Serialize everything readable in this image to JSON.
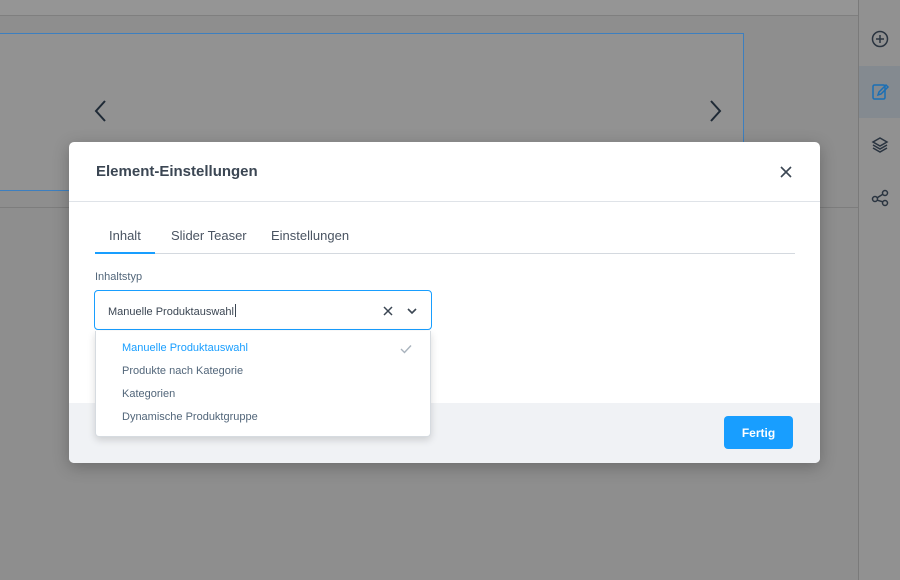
{
  "modal": {
    "title": "Element-Einstellungen",
    "tabs": [
      {
        "label": "Inhalt",
        "active": true
      },
      {
        "label": "Slider Teaser",
        "active": false
      },
      {
        "label": "Einstellungen",
        "active": false
      }
    ],
    "field_label": "Inhaltstyp",
    "select": {
      "value": "Manuelle Produktauswahl",
      "options": [
        {
          "label": "Manuelle Produktauswahl",
          "selected": true
        },
        {
          "label": "Produkte nach Kategorie",
          "selected": false
        },
        {
          "label": "Kategorien",
          "selected": false
        },
        {
          "label": "Dynamische Produktgruppe",
          "selected": false
        }
      ]
    },
    "done_label": "Fertig"
  },
  "sidebar": {
    "items": [
      {
        "icon": "plus-circle-icon"
      },
      {
        "icon": "edit-icon",
        "active": true
      },
      {
        "icon": "layers-icon"
      },
      {
        "icon": "share-icon"
      }
    ]
  },
  "colors": {
    "accent": "#189eff",
    "text": "#3b4653",
    "muted": "#52667a"
  }
}
